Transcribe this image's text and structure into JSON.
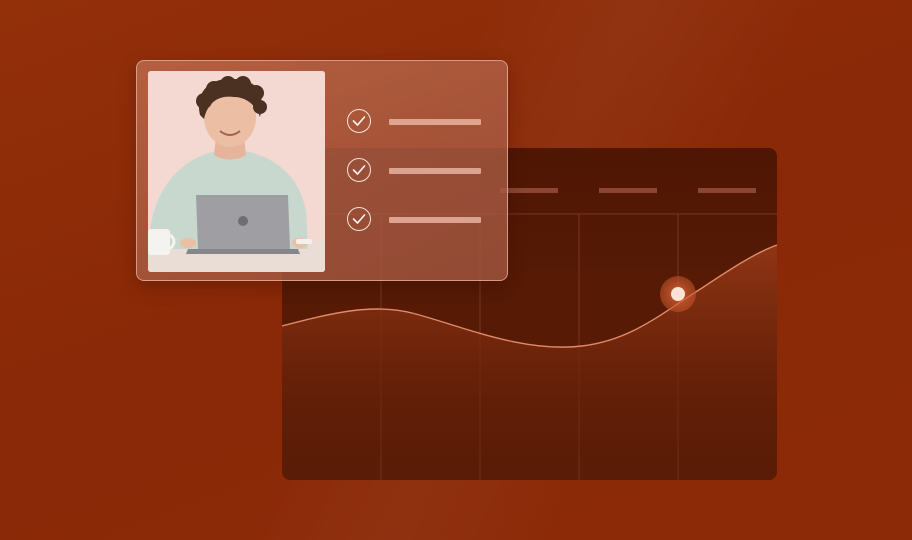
{
  "theme": {
    "background": "#8a2a06",
    "panel": "#521805",
    "accent_dot": "#fbe3d6",
    "card_tint": "#b86e52"
  },
  "chart_panel": {
    "header_placeholders": 3,
    "columns": 5,
    "highlight_point_index": 4
  },
  "overlay_card": {
    "photo_icon": "person-with-laptop-photo",
    "checklist": [
      {
        "icon": "check-circle-icon",
        "checked": true
      },
      {
        "icon": "check-circle-icon",
        "checked": true
      },
      {
        "icon": "check-circle-icon",
        "checked": true
      }
    ]
  }
}
